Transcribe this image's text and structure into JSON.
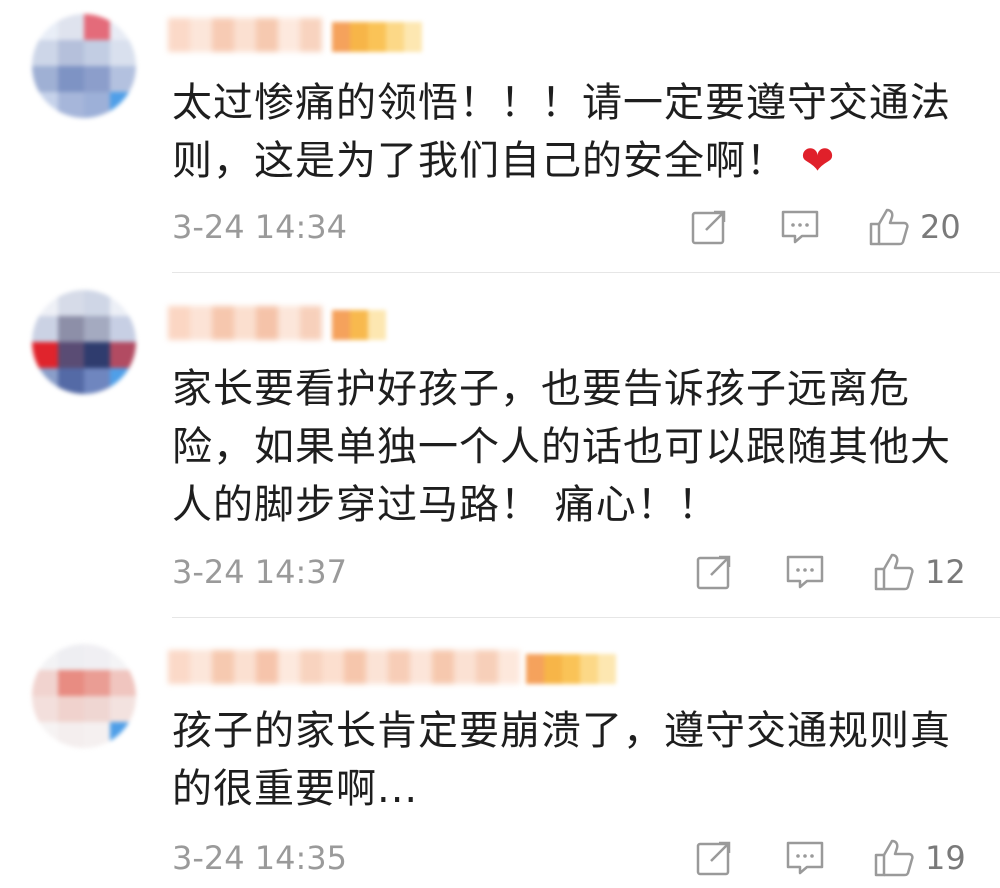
{
  "comments": [
    {
      "text": "太过惨痛的领悟！！！请一定要遵守交通法则，这是为了我们自己的安全啊！",
      "emoji": "heart-emoji",
      "time": "3-24 14:34",
      "likes": "20"
    },
    {
      "text": "家长要看护好孩子，也要告诉孩子远离危险，如果单独一个人的话也可以跟随其他大人的脚步穿过马路！ 痛心！！",
      "time": "3-24 14:37",
      "likes": "12"
    },
    {
      "text": "孩子的家长肯定要崩溃了，遵守交通规则真的很重要啊...",
      "time": "3-24 14:35",
      "likes": "19"
    }
  ],
  "icons": {
    "share": "share-icon",
    "reply": "comment-icon",
    "like": "thumbs-up-icon"
  },
  "colors": {
    "text": "#1e1e1e",
    "meta": "#9a9a9a",
    "heart": "#e0202a",
    "divider": "#e6e6e6"
  }
}
